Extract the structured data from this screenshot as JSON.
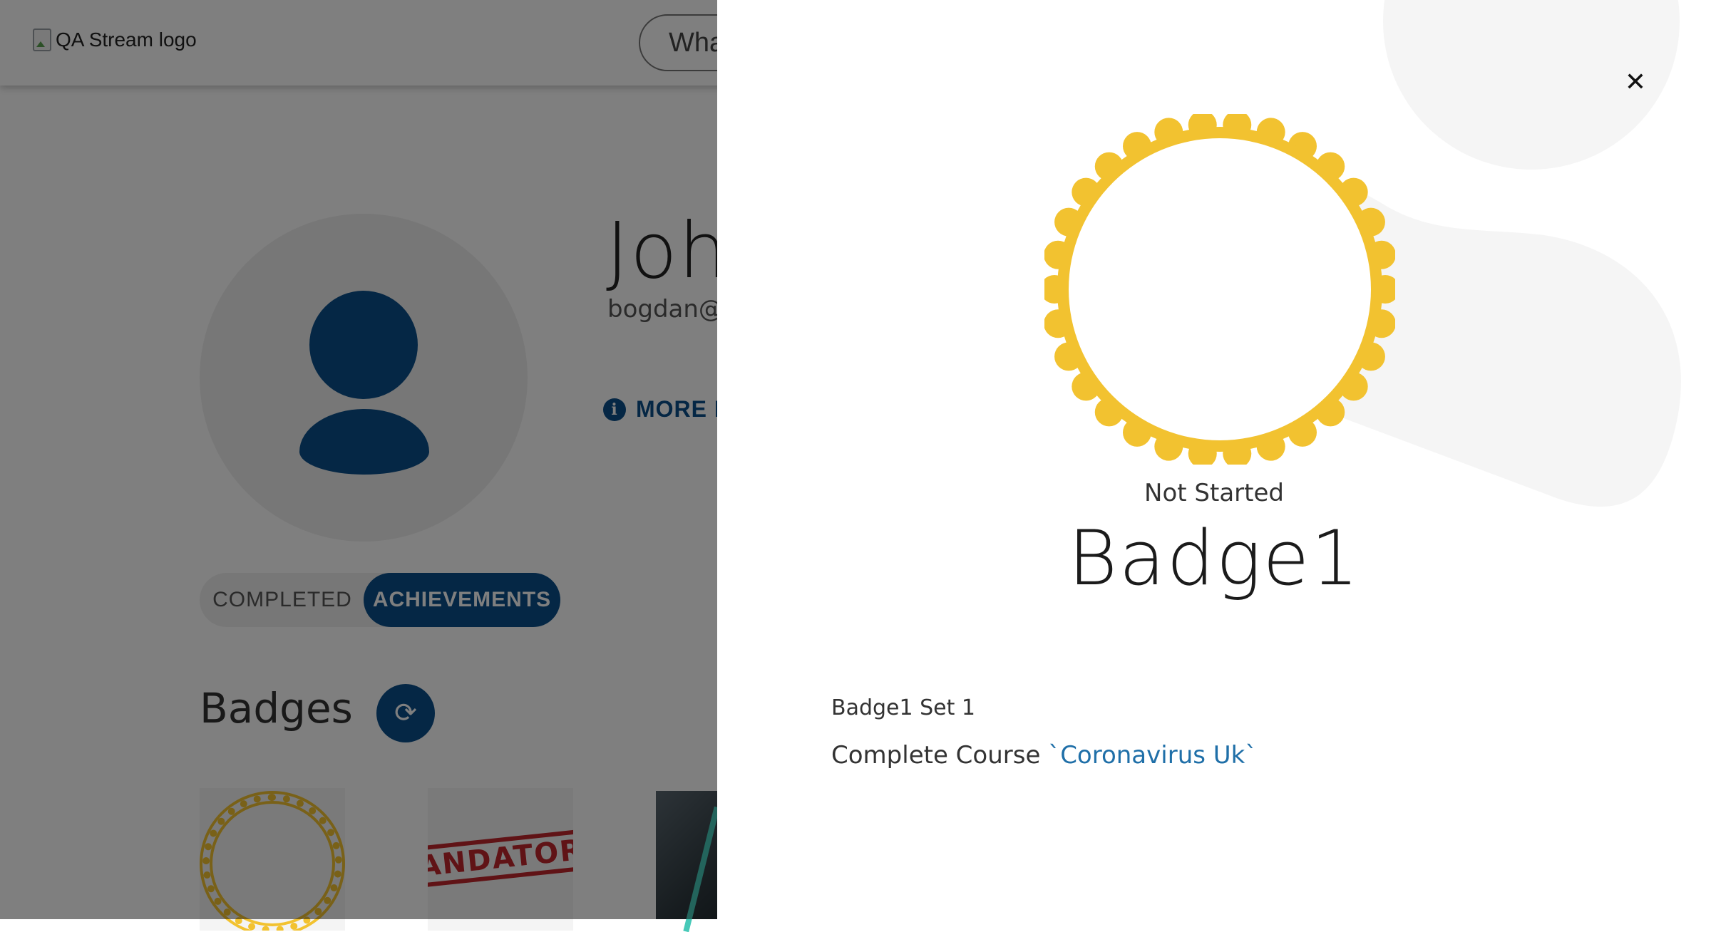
{
  "header": {
    "logo_alt": "QA Stream logo",
    "search_text": "Wha"
  },
  "profile": {
    "name": "Joh",
    "email": "bogdan@",
    "more_info_label": "MORE IN"
  },
  "tabs": [
    {
      "label": "COMPLETED",
      "active": false
    },
    {
      "label": "ACHIEVEMENTS",
      "active": true
    }
  ],
  "badges_section": {
    "title": "Badges",
    "refresh_icon": "refresh-icon",
    "cards": [
      {
        "type": "ring-badge"
      },
      {
        "type": "stamp",
        "text": "IANDATORY"
      },
      {
        "type": "photo"
      }
    ]
  },
  "drawer": {
    "close_icon": "close-icon",
    "status": "Not Started",
    "title": "Badge1",
    "set_label": "Badge1 Set 1",
    "requirement_prefix": "Complete Course ",
    "requirement_open_tick": "`",
    "requirement_link": "Coronavirus Uk",
    "requirement_close_tick": "`"
  },
  "colors": {
    "brand_blue": "#0a4e8a",
    "badge_gold": "#f2c230",
    "link_blue": "#1f6fa8",
    "overlay": "rgba(0,0,0,0.5)"
  }
}
